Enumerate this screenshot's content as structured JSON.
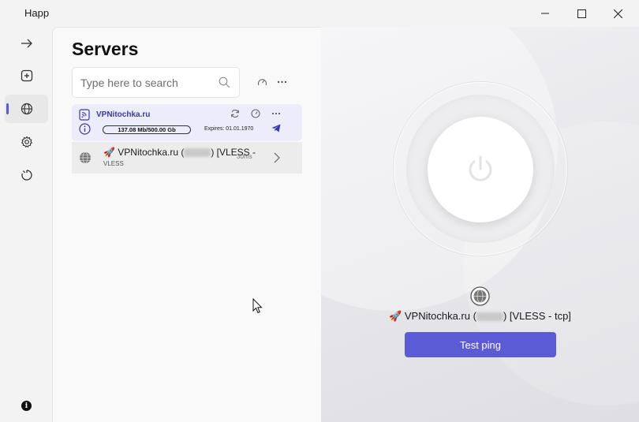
{
  "app": {
    "title": "Happ"
  },
  "window_controls": {
    "minimize": "minimize",
    "maximize": "maximize",
    "close": "close"
  },
  "sidebar": {
    "items": [
      {
        "icon": "arrow-right-icon"
      },
      {
        "icon": "add-square-icon"
      },
      {
        "icon": "globe-icon",
        "active": true
      },
      {
        "icon": "gear-icon"
      },
      {
        "icon": "timer-icon"
      }
    ],
    "info_label": "i"
  },
  "servers": {
    "title": "Servers",
    "search_placeholder": "Type here to search",
    "subscription": {
      "name": "VPNitochka.ru",
      "traffic": "137.08 Mb/500.00 Gb",
      "expires": "Expires: 01.01.1970"
    },
    "items": [
      {
        "name_prefix": "VPNitochka.ru (",
        "name_suffix": ") [VLESS -",
        "protocol": "VLESS",
        "ping": "30ms"
      }
    ]
  },
  "connection": {
    "server_prefix": "VPNitochka.ru (",
    "server_suffix": ") [VLESS - tcp]",
    "test_ping_label": "Test ping"
  },
  "colors": {
    "accent": "#5b5bd6",
    "subscription_bg": "#ececfb"
  }
}
